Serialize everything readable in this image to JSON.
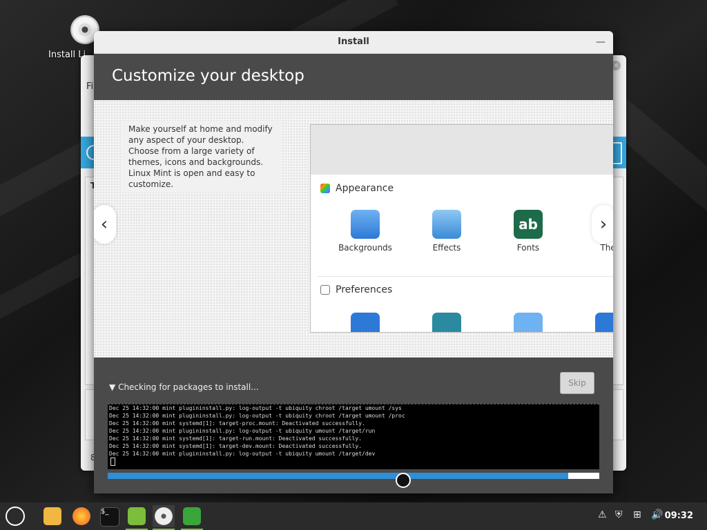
{
  "desktop": {
    "icon_label": "Install Li"
  },
  "background_window": {
    "partial_label_1": "Fi",
    "partial_label_2": "T",
    "partial_label_3": "8"
  },
  "window": {
    "title": "Install",
    "heading": "Customize your desktop"
  },
  "slide": {
    "description": "Make yourself at home and modify any aspect of your desktop. Choose from a large variety of themes, icons and backgrounds. Linux Mint is open and easy to customize.",
    "prev_arrow": "‹",
    "next_arrow": "›",
    "sections": {
      "appearance": "Appearance",
      "preferences": "Preferences"
    },
    "appearance_items": [
      "Backgrounds",
      "Effects",
      "Fonts",
      "Ther"
    ],
    "font_icon_text": "ab"
  },
  "install": {
    "status": "Checking for packages to install...",
    "skip_label": "Skip",
    "progress": 0.937,
    "log_lines": [
      "Dec 25 14:32:00 mint plugininstall.py: log-output -t ubiquity chroot /target umount /sys",
      "Dec 25 14:32:00 mint plugininstall.py: log-output -t ubiquity chroot /target umount /proc",
      "Dec 25 14:32:00 mint systemd[1]: target-proc.mount: Deactivated successfully.",
      "Dec 25 14:32:00 mint plugininstall.py: log-output -t ubiquity umount /target/run",
      "Dec 25 14:32:00 mint systemd[1]: target-run.mount: Deactivated successfully.",
      "Dec 25 14:32:00 mint systemd[1]: target-dev.mount: Deactivated successfully.",
      "Dec 25 14:32:00 mint plugininstall.py: log-output -t ubiquity umount /target/dev"
    ]
  },
  "taskbar": {
    "clock": "09:32",
    "terminal_glyph": "$_"
  },
  "colors": {
    "accent_blue": "#2f8fd6",
    "mint_green": "#7cbd3c"
  }
}
